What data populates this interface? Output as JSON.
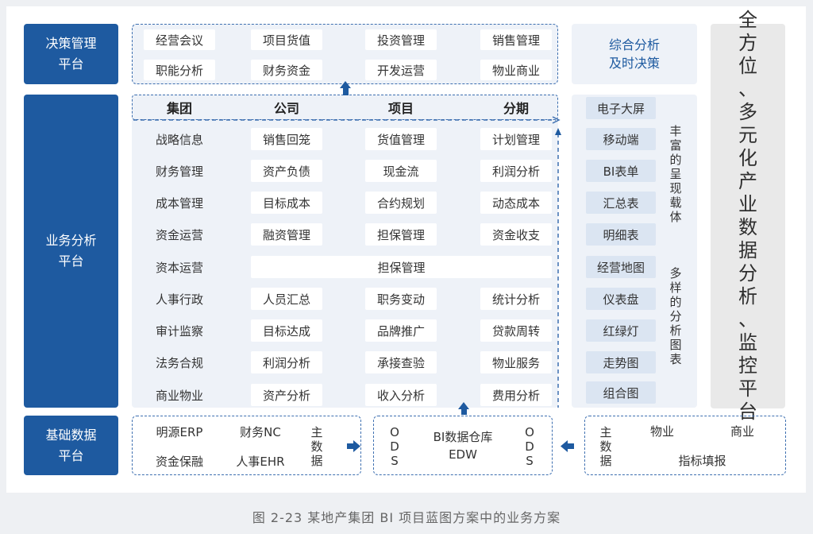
{
  "platforms": {
    "decision": "决策管理\n平台",
    "business": "业务分析\n平台",
    "base": "基础数据\n平台"
  },
  "decision_items": [
    "经营会议",
    "项目货值",
    "投资管理",
    "销售管理",
    "职能分析",
    "财务资金",
    "开发运营",
    "物业商业"
  ],
  "summary": "综合分析\n及时决策",
  "headers": [
    "集团",
    "公司",
    "项目",
    "分期"
  ],
  "rows": [
    [
      "战略信息",
      "销售回笼",
      "货值管理",
      "计划管理"
    ],
    [
      "财务管理",
      "资产负债",
      "现金流",
      "利润分析"
    ],
    [
      "成本管理",
      "目标成本",
      "合约规划",
      "动态成本"
    ],
    [
      "资金运营",
      "融资管理",
      "担保管理",
      "资金收支"
    ],
    [
      "资本运营",
      "担保管理"
    ],
    [
      "人事行政",
      "人员汇总",
      "职务变动",
      "统计分析"
    ],
    [
      "审计监察",
      "目标达成",
      "品牌推广",
      "贷款周转"
    ],
    [
      "法务合规",
      "利润分析",
      "承接查验",
      "物业服务"
    ],
    [
      "商业物业",
      "资产分析",
      "收入分析",
      "费用分析"
    ]
  ],
  "carriers": [
    "电子大屏",
    "移动端",
    "BI表单",
    "汇总表",
    "明细表",
    "经营地图",
    "仪表盘",
    "红绿灯",
    "走势图",
    "组合图"
  ],
  "rich_label": "丰富的呈现载体",
  "diverse_label": "多样的分析图表",
  "big_title": "全方位、多元化产业数据分析、监控平台",
  "base_left": [
    "明源ERP",
    "财务NC",
    "资金保融",
    "人事EHR"
  ],
  "master_data": "主数据",
  "ods": "ODS",
  "edw": "BI数据仓库\nEDW",
  "base_right": [
    "物业",
    "商业",
    "指标填报"
  ],
  "caption": "图 2-23  某地产集团 BI 项目蓝图方案中的业务方案"
}
